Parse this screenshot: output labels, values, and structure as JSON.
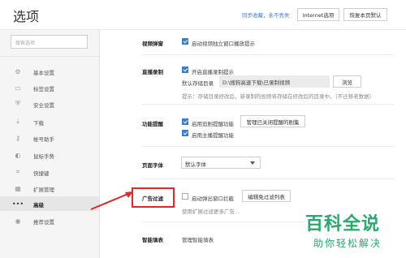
{
  "header": {
    "title": "选项",
    "sync_link": "同步收藏，永不丢失",
    "internet_options_button": "Internet选项",
    "restore_defaults_button": "恢复本页默认"
  },
  "sidebar": {
    "search_placeholder": "搜索选项",
    "items": [
      {
        "label": "基本设置",
        "icon": "gear-icon"
      },
      {
        "label": "标签设置",
        "icon": "tab-icon"
      },
      {
        "label": "安全设置",
        "icon": "shield-icon"
      },
      {
        "label": "下载",
        "icon": "download-icon"
      },
      {
        "label": "帐号助手",
        "icon": "key-icon"
      },
      {
        "label": "鼠标手势",
        "icon": "mouse-icon"
      },
      {
        "label": "快捷键",
        "icon": "shortcut-icon"
      },
      {
        "label": "扩展管理",
        "icon": "puzzle-icon"
      },
      {
        "label": "高级",
        "icon": "more-icon",
        "active": true
      },
      {
        "label": "推荐设置",
        "icon": "recommend-icon"
      }
    ]
  },
  "main": {
    "video_popup": {
      "label": "视频弹窗",
      "option": "启动视频独立窗口播放提示",
      "checked": true
    },
    "live_record": {
      "label": "直播录制",
      "option": "开启直播录制提示",
      "checked": true,
      "dir_label": "默认存储目录",
      "dir_value": "D:\\搜狗高速下载\\已录制视频",
      "browse_button": "浏览",
      "hint": "提示：存储目录修改后，新录制的视频将存储在修改后的目录中。（不迁移老数据）"
    },
    "feature_reminder": {
      "label": "功能提醒",
      "option1": "启用追剧提醒功能",
      "option1_checked": true,
      "manage_button": "管理已关闭提醒的剧集",
      "option2": "启用主播提醒功能",
      "option2_checked": true
    },
    "page_font": {
      "label": "页面字体",
      "selected": "默认字体"
    },
    "ad_filter": {
      "label": "广告过滤",
      "option": "启动弹出窗口拦截",
      "checked": false,
      "edit_button": "编辑免过滤列表",
      "sub_text": "使用扩展过滤更多广告..."
    },
    "smart_fill": {
      "label": "智能填表",
      "option": "管理智能填表"
    }
  },
  "watermark": {
    "title": "百科全说",
    "subtitle": "助你轻松解决"
  },
  "colors": {
    "accent": "#3a7bd5",
    "highlight_box": "#e02a2a",
    "watermark": "#2aa86e"
  }
}
